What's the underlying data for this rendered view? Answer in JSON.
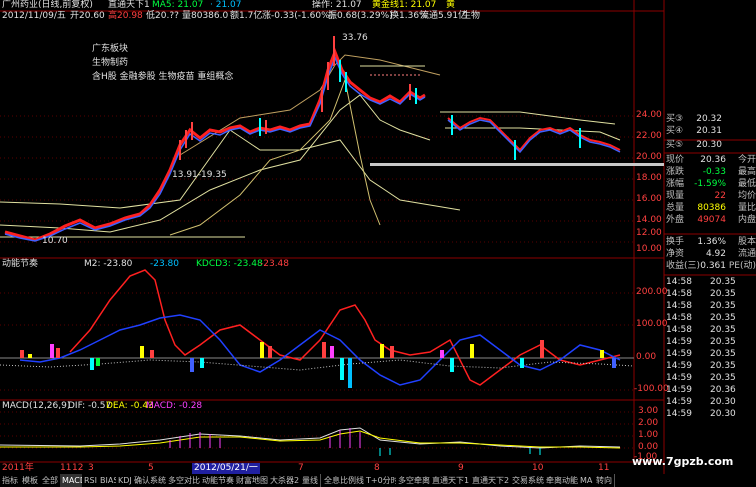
{
  "header": {
    "title": "广州药业(日线,前复权)",
    "indicator_name": "直通天下1",
    "ma_label": "MA5: 21.07",
    "ma2": "· 21.07",
    "op_label": "操作: 21.07",
    "golden_label": "黄金线1: 21.07",
    "extra": "黄"
  },
  "info_line": {
    "date": "2012/11/09/五",
    "open": "开20.60",
    "high": "高20.98",
    "low": "低20.??",
    "volume": "量80386.0",
    "amount": "额1.7亿",
    "change": "涨-0.33(-1.60%)",
    "amplitude": "振0.68(3.29%)",
    "turnover": "换1.36%",
    "float": "流通5.91亿",
    "extra": "生物"
  },
  "annotations": {
    "block1": "广东板块",
    "block2": "生物制药",
    "block3": "含H股 金融参股 生物疫苗 重组概念",
    "peak": "33.76",
    "level": "13.91-19.35",
    "low": "10.70"
  },
  "price_axis": [
    "24.00",
    "22.00",
    "20.00",
    "18.00",
    "16.00",
    "14.00",
    "12.00",
    "10.00"
  ],
  "mid_panel": {
    "title": "动能节奏",
    "m2": "M2: -23.80",
    "m2b": "-23.80",
    "kdcd": "KDCD3: -23.48",
    "kdcd2": "-23.48",
    "axis": [
      "200.00",
      "100.00",
      "0.00",
      "-100.00"
    ]
  },
  "macd_panel": {
    "title": "MACD(12,26,9)",
    "dif": "DIF: -0.57",
    "dea": "DEA: -0.43",
    "macd": "MACD: -0.28",
    "axis": [
      "3.00",
      "2.00",
      "1.00",
      "0.00",
      "-1.00"
    ]
  },
  "timeline": {
    "year": "2011年",
    "selected_date": "2012/05/21/一",
    "marks": [
      "11",
      "12",
      "3",
      "5",
      "7",
      "8",
      "9",
      "10",
      "11"
    ]
  },
  "quote": {
    "buy3": {
      "label": "买③",
      "value": "20.32"
    },
    "buy4": {
      "label": "买④",
      "value": "20.31"
    },
    "buy5": {
      "label": "买⑤",
      "value": "20.30"
    },
    "rows": [
      {
        "label": "现价",
        "value": "20.36",
        "label2": "今开"
      },
      {
        "label": "涨跌",
        "value": "-0.33",
        "label2": "最高"
      },
      {
        "label": "涨幅",
        "value": "-1.59%",
        "label2": "最低"
      },
      {
        "label": "现量",
        "value": "22",
        "label2": "均价"
      },
      {
        "label": "总量",
        "value": "80386",
        "label2": "量比"
      },
      {
        "label": "外盘",
        "value": "49074",
        "label2": "内盘"
      },
      {
        "label": "换手",
        "value": "1.36%",
        "label2": "股本"
      },
      {
        "label": "净资",
        "value": "4.92",
        "label2": "流通"
      },
      {
        "label": "收益(三)",
        "value": "0.361",
        "label2": "PE(动)"
      }
    ],
    "ticks": [
      {
        "time": "14:58",
        "price": "20.35"
      },
      {
        "time": "14:58",
        "price": "20.35"
      },
      {
        "time": "14:58",
        "price": "20.35"
      },
      {
        "time": "14:58",
        "price": "20.35"
      },
      {
        "time": "14:58",
        "price": "20.35"
      },
      {
        "time": "14:59",
        "price": "20.35"
      },
      {
        "time": "14:59",
        "price": "20.35"
      },
      {
        "time": "14:59",
        "price": "20.35"
      },
      {
        "time": "14:59",
        "price": "20.35"
      },
      {
        "time": "14:59",
        "price": "20.36"
      },
      {
        "time": "14:59",
        "price": "20.30"
      },
      {
        "time": "14:59",
        "price": "20.30"
      }
    ]
  },
  "tabs": [
    "指标",
    "模板",
    "全部",
    "MACD",
    "RSI",
    "BIAS",
    "KDJ",
    "确认系统",
    "多空对比",
    "动能节奏",
    "财富地图",
    "大杀器2",
    "量线",
    "全息比例线",
    "T+0分时",
    "多空牵离",
    "直通天下1",
    "直通天下2",
    "交易系统",
    "牵离动能",
    "MA",
    "转向"
  ],
  "watermark": "www.7gpzb.com",
  "colors": {
    "up": "#ff3030",
    "down": "#00ffff",
    "yellow": "#ffff00",
    "grid": "#8b0000"
  }
}
